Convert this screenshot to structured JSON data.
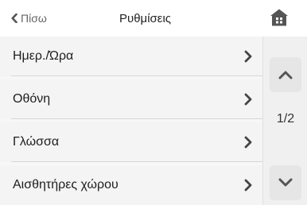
{
  "header": {
    "back_label": "Πίσω",
    "title": "Ρυθμίσεις",
    "home_icon": "home-icon"
  },
  "menu": {
    "items": [
      {
        "label": "Ημερ./Ώρα"
      },
      {
        "label": "Οθόνη"
      },
      {
        "label": "Γλώσσα"
      },
      {
        "label": "Αισθητήρες χώρου"
      }
    ]
  },
  "pager": {
    "indicator": "1/2"
  },
  "colors": {
    "accent": "#555555",
    "row_bg": "#f4f4f4",
    "pager_button_bg": "#e6e6e6"
  }
}
